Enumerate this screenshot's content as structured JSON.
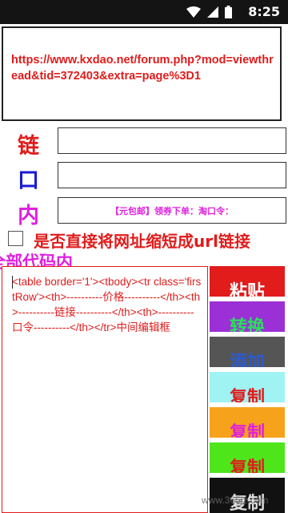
{
  "status_bar": {
    "time": "8:25",
    "icons": [
      "wifi-icon",
      "signal-icon",
      "battery-icon"
    ]
  },
  "url": {
    "text": "https://www.kxdao.net/forum.php?mod=viewthread&tid=372403&extra=page%3D1"
  },
  "labels": {
    "lian": "链",
    "kou": "口",
    "nei": "内"
  },
  "fields": {
    "field_lian_value": "",
    "field_kou_value": "",
    "field_nei_value": "【元包邮】领券下单：淘口令："
  },
  "checkbox": {
    "label": "是否直接将网址缩短成url链接",
    "checked": false
  },
  "all_code_label": "全部代码内",
  "editor": {
    "text": "<table border='1'><tbody><tr class='firstRow'><th>----------价格----------</th><th>----------链接----------</th><th>----------口令----------</th></tr>中间编辑框"
  },
  "buttons": [
    {
      "label": "粘贴"
    },
    {
      "label": "转换"
    },
    {
      "label": "添加"
    },
    {
      "label": "复制"
    },
    {
      "label": "复制"
    },
    {
      "label": "复制"
    },
    {
      "label": "复制"
    }
  ],
  "watermark": "www.365jz.com",
  "colors": {
    "accent_red": "#e01c1c",
    "accent_blue": "#1a1ad6",
    "accent_magenta": "#e020e0"
  }
}
